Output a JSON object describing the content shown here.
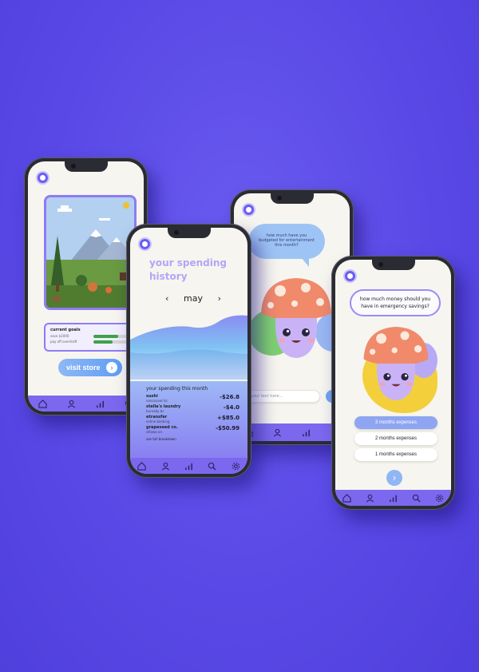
{
  "phone1": {
    "goals": {
      "title": "current goals",
      "items": [
        {
          "label": "save $2000",
          "progress": 0.7
        },
        {
          "label": "pay off overdraft",
          "progress": 0.55
        }
      ]
    },
    "store_button": "visit store"
  },
  "phone2": {
    "title": "your spending history",
    "month": "may",
    "panel_heading": "your spending this month",
    "transactions": [
      {
        "name": "sushi",
        "sub": "vancouver bc",
        "amount": "-$26.8"
      },
      {
        "name": "stella's laundry",
        "sub": "burnaby bc",
        "amount": "-$4.0"
      },
      {
        "name": "etransfer",
        "sub": "online banking",
        "amount": "+$85.0"
      },
      {
        "name": "grapeseed co.",
        "sub": "ottawa on",
        "amount": "-$50.99"
      }
    ],
    "full_link": "see full breakdown"
  },
  "phone3": {
    "question": "how much have you budgeted for entertainment this month?",
    "input_placeholder": "your text here..."
  },
  "phone4": {
    "question": "how much money should you have in emergency savings?",
    "options": [
      "3 months expenses",
      "2 months expenses",
      "1 months expenses"
    ],
    "selected_index": 0
  },
  "tabs": [
    "home-icon",
    "profile-icon",
    "stats-icon",
    "search-icon",
    "settings-icon"
  ],
  "colors": {
    "background": "#5a49e6",
    "accent": "#7b68ee",
    "screen": "#f7f5ef"
  }
}
